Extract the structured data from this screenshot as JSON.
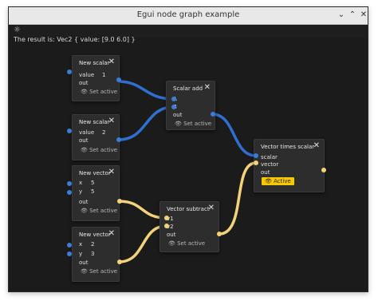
{
  "window": {
    "title": "Egui node graph example"
  },
  "toolbar": {
    "theme_icon": "☼"
  },
  "result": "The result is: Vec2 { value: [9.0 6.0] }",
  "common": {
    "close": "✕",
    "set_active": "👁 Set active",
    "out": "out"
  },
  "nodes": {
    "scalar1": {
      "title": "New scalar",
      "label": "value",
      "value": "1"
    },
    "scalar2": {
      "title": "New scalar",
      "label": "value",
      "value": "2"
    },
    "vector1": {
      "title": "New vector",
      "x_label": "x",
      "x": "5",
      "y_label": "y",
      "y": "5"
    },
    "vector2": {
      "title": "New vector",
      "x_label": "x",
      "x": "2",
      "y_label": "y",
      "y": "3"
    },
    "scalar_add": {
      "title": "Scalar add",
      "a": "A",
      "b": "B"
    },
    "vector_subtract": {
      "title": "Vector subtract",
      "v1": "v1",
      "v2": "v2"
    },
    "vector_times_scalar": {
      "title": "Vector times scalar",
      "scalar": "scalar",
      "vector": "vector",
      "active": "👁 Active"
    }
  },
  "colors": {
    "scalar_wire": "#2f6fd0",
    "vector_wire": "#f2d37a",
    "active_badge": "#f7c800"
  }
}
